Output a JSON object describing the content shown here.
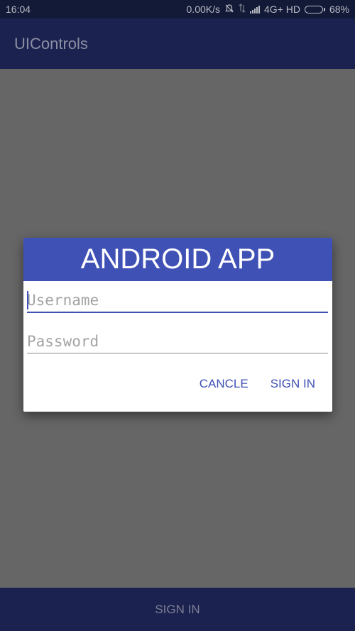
{
  "status_bar": {
    "time": "16:04",
    "network_speed": "0.00K/s",
    "icons": [
      "bell-muted-icon",
      "data-transfer-icon",
      "signal-icon",
      "battery-icon"
    ],
    "network_type": "4G+ HD",
    "battery_percent_label": "68%",
    "battery_level": 0.68
  },
  "app_bar": {
    "title": "UIControls"
  },
  "dialog": {
    "header": "ANDROID APP",
    "username": {
      "placeholder": "Username",
      "value": ""
    },
    "password": {
      "placeholder": "Password",
      "value": ""
    },
    "actions": {
      "cancel_label": "CANCLE",
      "signin_label": "SIGN IN"
    },
    "colors": {
      "accent": "#3f51b5"
    }
  },
  "bottom_bar": {
    "signin_label": "SIGN IN"
  },
  "colors": {
    "primary_dark": "#1c2250",
    "scrim": "#666666"
  }
}
